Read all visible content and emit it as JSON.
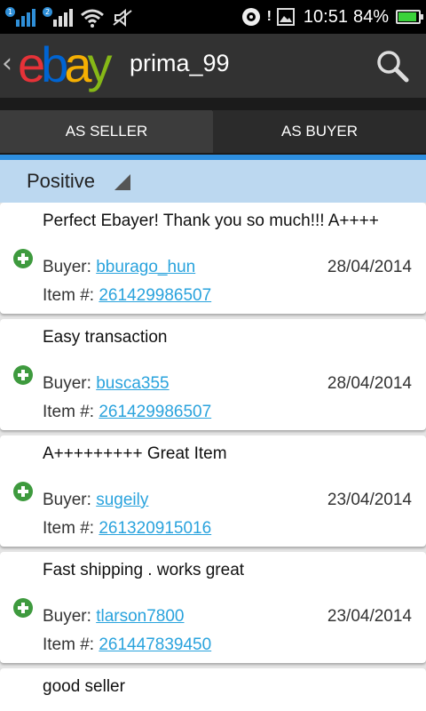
{
  "status_bar": {
    "sim1": "1",
    "sim2": "2",
    "time": "10:51",
    "battery_pct": "84%",
    "battery_level": 0.84,
    "icons": [
      "signal-icon",
      "signal-icon",
      "wifi-icon",
      "mute-icon",
      "sync-icon",
      "notification-icon",
      "image-icon",
      "battery-icon"
    ]
  },
  "app_bar": {
    "logo_letters": [
      "e",
      "b",
      "a",
      "y"
    ],
    "logo_colors": [
      "#e53238",
      "#0064d2",
      "#f5af02",
      "#86b817"
    ],
    "username": "prima_99"
  },
  "tabs": [
    {
      "label": "AS SELLER",
      "selected": false
    },
    {
      "label": "AS BUYER",
      "selected": true
    }
  ],
  "filter": {
    "label": "Positive"
  },
  "feedback": [
    {
      "comment": "Perfect Ebayer! Thank you so much!!! A++++",
      "buyer_label": "Buyer:",
      "buyer": "bburago_hun",
      "date": "28/04/2014",
      "item_label": "Item #:",
      "item": "261429986507",
      "rating": "positive"
    },
    {
      "comment": "Easy transaction",
      "buyer_label": "Buyer:",
      "buyer": "busca355",
      "date": "28/04/2014",
      "item_label": "Item #:",
      "item": "261429986507",
      "rating": "positive"
    },
    {
      "comment": "A+++++++++ Great Item",
      "buyer_label": "Buyer:",
      "buyer": "sugeily",
      "date": "23/04/2014",
      "item_label": "Item #:",
      "item": "261320915016",
      "rating": "positive"
    },
    {
      "comment": "Fast shipping . works great",
      "buyer_label": "Buyer:",
      "buyer": "tlarson7800",
      "date": "23/04/2014",
      "item_label": "Item #:",
      "item": "261447839450",
      "rating": "positive"
    },
    {
      "comment": "good seller",
      "buyer_label": "",
      "buyer": "",
      "date": "",
      "item_label": "",
      "item": "",
      "rating": "positive"
    }
  ],
  "colors": {
    "accent": "#2e8fe0",
    "link": "#2aa3dd",
    "positive": "#3e9a3e",
    "filter_bg": "#bcd8f0"
  }
}
